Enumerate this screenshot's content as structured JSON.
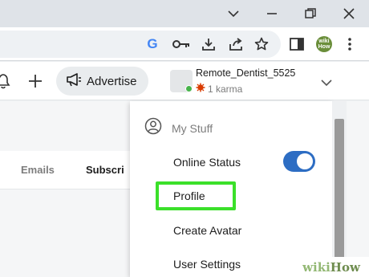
{
  "browser": {
    "window_controls": [
      {
        "name": "chevron-down-icon"
      },
      {
        "name": "minimize-icon"
      },
      {
        "name": "restore-icon"
      },
      {
        "name": "close-icon"
      }
    ],
    "toolbar_icons": [
      {
        "name": "google-icon",
        "label": "G"
      },
      {
        "name": "key-icon"
      },
      {
        "name": "download-icon"
      },
      {
        "name": "share-icon"
      },
      {
        "name": "bookmark-star-icon"
      },
      {
        "name": "sidebar-icon"
      },
      {
        "name": "extension-icon",
        "label": "wiki How"
      },
      {
        "name": "kebab-menu-icon"
      }
    ]
  },
  "header": {
    "advertise_label": "Advertise",
    "user": {
      "username": "Remote_Dentist_5525",
      "karma": "1 karma",
      "online": true
    }
  },
  "tabs": {
    "emails": "Emails",
    "subscriptions": "Subscri"
  },
  "dropdown": {
    "section_label": "My Stuff",
    "items": [
      {
        "label": "Online Status",
        "toggle_on": true
      },
      {
        "label": "Profile",
        "highlighted": true
      },
      {
        "label": "Create Avatar"
      },
      {
        "label": "User Settings"
      }
    ]
  },
  "colors": {
    "toggle_on": "#2d6dc3",
    "highlight": "#3be02a",
    "online": "#46b34a",
    "karma_icon": "#d93a00"
  },
  "watermark": {
    "wiki": "wiki",
    "how": "How"
  }
}
